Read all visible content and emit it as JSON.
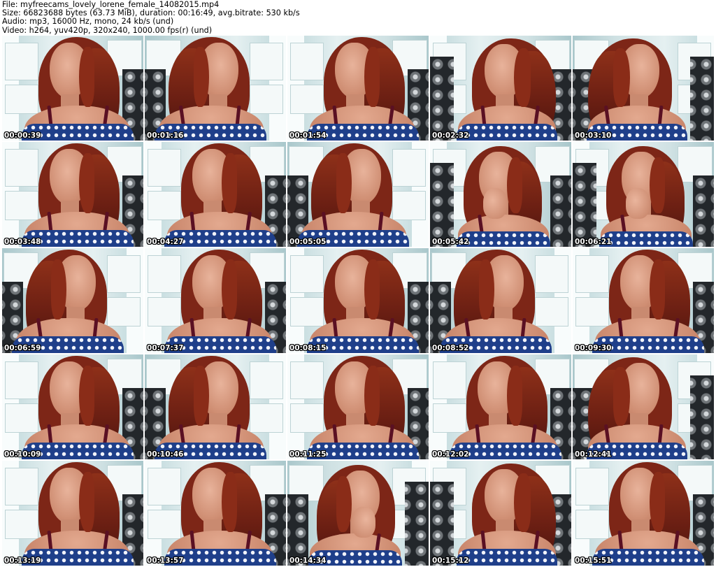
{
  "header": {
    "file_line": "File: myfreecams_lovely_lorene_female_14082015.mp4",
    "size_line": "Size: 66823688 bytes (63.73 MiB), duration: 00:16:49, avg.bitrate: 530 kb/s",
    "audio_line": "Audio: mp3, 16000 Hz, mono, 24 kb/s (und)",
    "video_line": "Video: h264, yuv420p, 320x240, 1000.00 fps(r) (und)"
  },
  "grid": {
    "columns": 5,
    "rows": 5
  },
  "thumbnails": [
    {
      "timestamp": "00:00:39",
      "variant": "a"
    },
    {
      "timestamp": "00:01:16",
      "variant": "a"
    },
    {
      "timestamp": "00:01:54",
      "variant": "a"
    },
    {
      "timestamp": "00:02:32",
      "variant": "b"
    },
    {
      "timestamp": "00:03:10",
      "variant": "b"
    },
    {
      "timestamp": "00:03:48",
      "variant": "a"
    },
    {
      "timestamp": "00:04:27",
      "variant": "a"
    },
    {
      "timestamp": "00:05:05",
      "variant": "a"
    },
    {
      "timestamp": "00:05:42",
      "variant": "c"
    },
    {
      "timestamp": "00:06:21",
      "variant": "c"
    },
    {
      "timestamp": "00:06:59",
      "variant": "a"
    },
    {
      "timestamp": "00:07:37",
      "variant": "a"
    },
    {
      "timestamp": "00:08:15",
      "variant": "a"
    },
    {
      "timestamp": "00:08:52",
      "variant": "a"
    },
    {
      "timestamp": "00:09:30",
      "variant": "a"
    },
    {
      "timestamp": "00:10:09",
      "variant": "a"
    },
    {
      "timestamp": "00:10:46",
      "variant": "a"
    },
    {
      "timestamp": "00:11:25",
      "variant": "a"
    },
    {
      "timestamp": "00:12:02",
      "variant": "a"
    },
    {
      "timestamp": "00:12:41",
      "variant": "b"
    },
    {
      "timestamp": "00:13:19",
      "variant": "a"
    },
    {
      "timestamp": "00:13:57",
      "variant": "a"
    },
    {
      "timestamp": "00:14:34",
      "variant": "c"
    },
    {
      "timestamp": "00:15:12",
      "variant": "b"
    },
    {
      "timestamp": "00:15:51",
      "variant": "a"
    }
  ]
}
